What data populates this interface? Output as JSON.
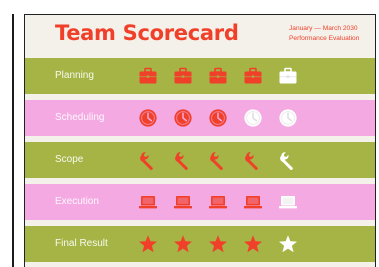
{
  "scorecard": {
    "title": "Team Scorecard",
    "subtitle_line1": "January — March 2030",
    "subtitle_line2": "Performance Evaluation",
    "colors": {
      "accent": "#f0402a",
      "olive_row": "#a5b444",
      "pink_row": "#f4a9e3",
      "inactive_icon": "#ffffff"
    },
    "rows": [
      {
        "label": "Planning",
        "icon": "briefcase-icon",
        "score": 4,
        "max": 5
      },
      {
        "label": "Scheduling",
        "icon": "clock-icon",
        "score": 3,
        "max": 5
      },
      {
        "label": "Scope",
        "icon": "wrench-icon",
        "score": 4,
        "max": 5
      },
      {
        "label": "Execution",
        "icon": "laptop-icon",
        "score": 4,
        "max": 5
      },
      {
        "label": "Final Result",
        "icon": "star-icon",
        "score": 4,
        "max": 5
      }
    ]
  }
}
